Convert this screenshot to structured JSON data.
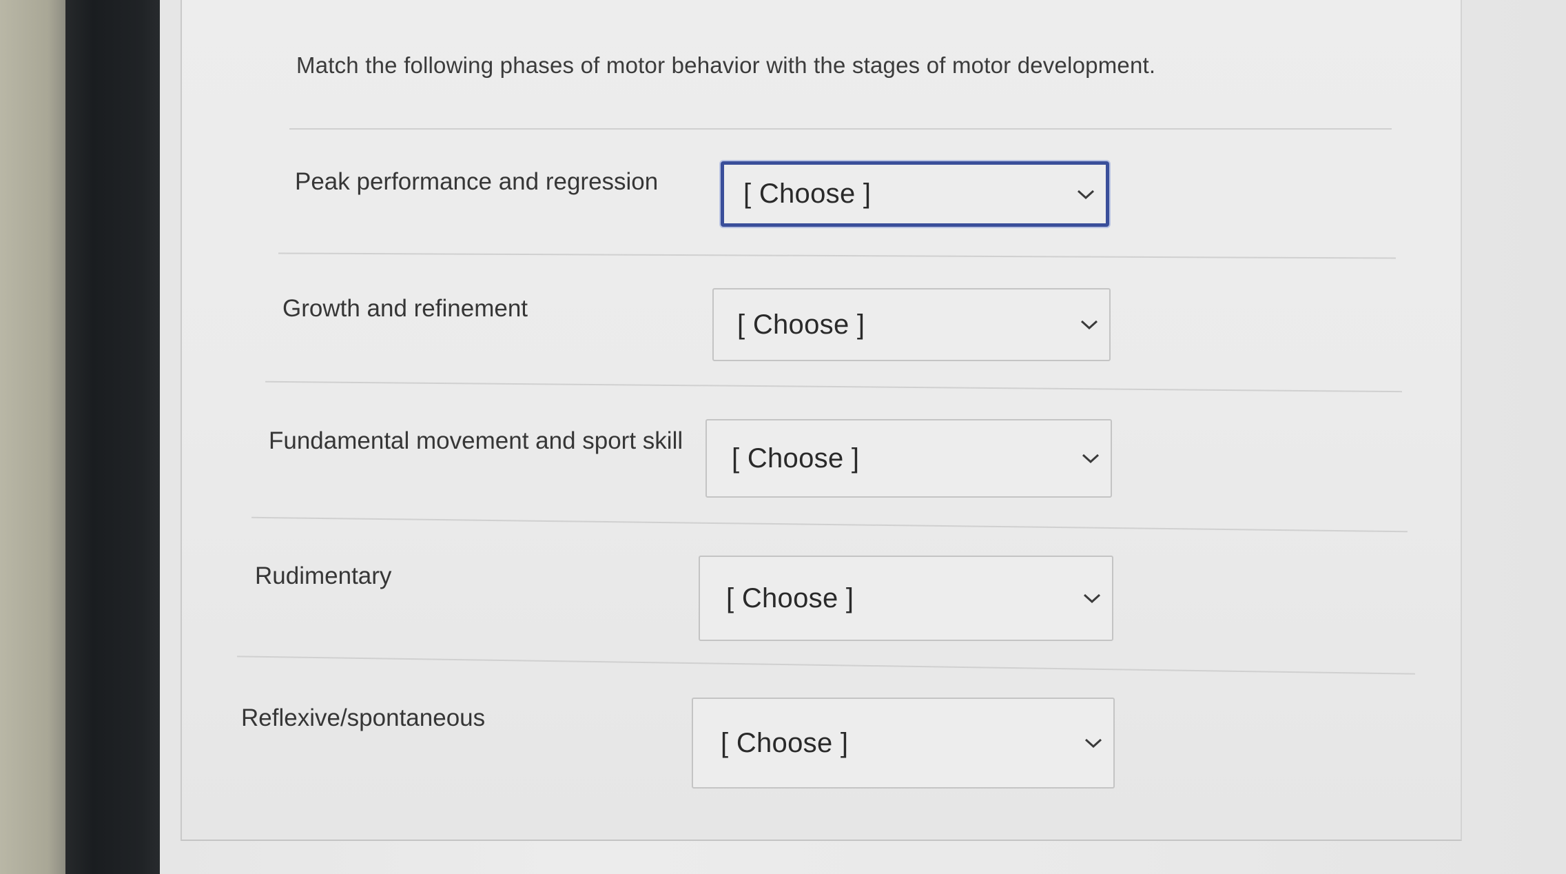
{
  "question": {
    "prompt": "Match the following phases of motor behavior with the stages of motor development."
  },
  "rows": [
    {
      "label": "Peak performance and regression",
      "selected": "[ Choose ]"
    },
    {
      "label": "Growth and refinement",
      "selected": "[ Choose ]"
    },
    {
      "label": "Fundamental movement and sport skill",
      "selected": "[ Choose ]"
    },
    {
      "label": "Rudimentary",
      "selected": "[ Choose ]"
    },
    {
      "label": "Reflexive/spontaneous",
      "selected": "[ Choose ]"
    }
  ],
  "icons": {
    "dropdown": "chevron-down-icon"
  },
  "colors": {
    "focus_border": "#3a4f9a",
    "text": "#363636",
    "background": "#ebebeb"
  }
}
